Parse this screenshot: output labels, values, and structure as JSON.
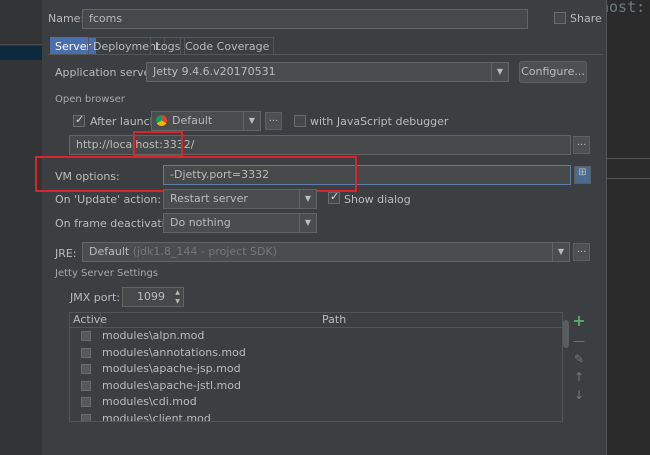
{
  "editor": {
    "code_fragment": "host:"
  },
  "header": {
    "name_label": "Name:",
    "name_value": "fcoms",
    "share_label": "Share",
    "share_checked": false
  },
  "tabs": [
    {
      "label": "Server",
      "active": true
    },
    {
      "label": "Deployment",
      "active": false
    },
    {
      "label": "Logs",
      "active": false
    },
    {
      "label": "Code Coverage",
      "active": false
    }
  ],
  "server": {
    "app_server_label": "Application server:",
    "app_server_value": "Jetty 9.4.6.v20170531",
    "configure_label": "Configure...",
    "open_browser_label": "Open browser",
    "after_launch_label": "After launch",
    "after_launch_checked": true,
    "browser_value": "Default",
    "ellipsis": "...",
    "js_debugger_label": "with JavaScript debugger",
    "js_debugger_checked": false,
    "url_value": "http://localhost:3332/",
    "vm_options_label": "VM options:",
    "vm_options_value": "-Djetty.port=3332",
    "on_update_label": "On 'Update' action:",
    "on_update_value": "Restart server",
    "show_dialog_label": "Show dialog",
    "show_dialog_checked": true,
    "on_frame_label": "On frame deactivation:",
    "on_frame_value": "Do nothing",
    "jre_label": "JRE:",
    "jre_value": "Default",
    "jre_detail": "(jdk1.8_144 - project SDK)",
    "jetty_settings_label": "Jetty Server Settings",
    "jmx_port_label": "JMX port:",
    "jmx_port_value": "1099"
  },
  "modules_table": {
    "columns": [
      "Active",
      "Path"
    ],
    "rows": [
      {
        "active": false,
        "path": "modules\\alpn.mod"
      },
      {
        "active": false,
        "path": "modules\\annotations.mod"
      },
      {
        "active": false,
        "path": "modules\\apache-jsp.mod"
      },
      {
        "active": false,
        "path": "modules\\apache-jstl.mod"
      },
      {
        "active": false,
        "path": "modules\\cdi.mod"
      },
      {
        "active": false,
        "path": "modules\\client.mod"
      }
    ]
  },
  "colors": {
    "accent": "#4b6eaf",
    "highlight": "#d9232d",
    "add_icon": "#59a869"
  }
}
